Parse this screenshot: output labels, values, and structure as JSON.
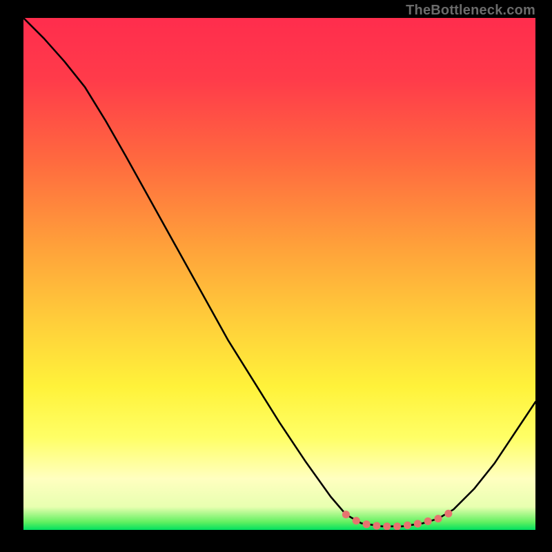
{
  "watermark": "TheBottleneck.com",
  "chart_data": {
    "type": "line",
    "title": "",
    "xlabel": "",
    "ylabel": "",
    "xlim": [
      0,
      100
    ],
    "ylim": [
      0,
      100
    ],
    "gradient_stops": [
      {
        "offset": 0.0,
        "color": "#ff2d4d"
      },
      {
        "offset": 0.12,
        "color": "#ff3b4a"
      },
      {
        "offset": 0.28,
        "color": "#ff6a3f"
      },
      {
        "offset": 0.45,
        "color": "#ffa23a"
      },
      {
        "offset": 0.6,
        "color": "#ffd03a"
      },
      {
        "offset": 0.72,
        "color": "#fff23a"
      },
      {
        "offset": 0.82,
        "color": "#ffff66"
      },
      {
        "offset": 0.9,
        "color": "#ffffc0"
      },
      {
        "offset": 0.955,
        "color": "#e8ffb0"
      },
      {
        "offset": 0.985,
        "color": "#60f060"
      },
      {
        "offset": 1.0,
        "color": "#00e060"
      }
    ],
    "curve_points": [
      {
        "x": 0.0,
        "y": 100.0
      },
      {
        "x": 4.0,
        "y": 96.0
      },
      {
        "x": 8.0,
        "y": 91.5
      },
      {
        "x": 12.0,
        "y": 86.5
      },
      {
        "x": 16.0,
        "y": 80.0
      },
      {
        "x": 20.0,
        "y": 73.0
      },
      {
        "x": 25.0,
        "y": 64.0
      },
      {
        "x": 30.0,
        "y": 55.0
      },
      {
        "x": 35.0,
        "y": 46.0
      },
      {
        "x": 40.0,
        "y": 37.0
      },
      {
        "x": 45.0,
        "y": 29.0
      },
      {
        "x": 50.0,
        "y": 21.0
      },
      {
        "x": 55.0,
        "y": 13.5
      },
      {
        "x": 60.0,
        "y": 6.5
      },
      {
        "x": 63.0,
        "y": 3.0
      },
      {
        "x": 66.0,
        "y": 1.3
      },
      {
        "x": 70.0,
        "y": 0.7
      },
      {
        "x": 74.0,
        "y": 0.7
      },
      {
        "x": 78.0,
        "y": 1.3
      },
      {
        "x": 81.0,
        "y": 2.2
      },
      {
        "x": 84.0,
        "y": 4.0
      },
      {
        "x": 88.0,
        "y": 8.0
      },
      {
        "x": 92.0,
        "y": 13.0
      },
      {
        "x": 96.0,
        "y": 19.0
      },
      {
        "x": 100.0,
        "y": 25.0
      }
    ],
    "marker_points": [
      {
        "x": 63.0,
        "y": 3.0
      },
      {
        "x": 65.0,
        "y": 1.8
      },
      {
        "x": 67.0,
        "y": 1.1
      },
      {
        "x": 69.0,
        "y": 0.8
      },
      {
        "x": 71.0,
        "y": 0.7
      },
      {
        "x": 73.0,
        "y": 0.7
      },
      {
        "x": 75.0,
        "y": 0.9
      },
      {
        "x": 77.0,
        "y": 1.2
      },
      {
        "x": 79.0,
        "y": 1.7
      },
      {
        "x": 81.0,
        "y": 2.2
      },
      {
        "x": 83.0,
        "y": 3.2
      }
    ],
    "marker_color": "#e6746f",
    "curve_color": "#000000"
  }
}
